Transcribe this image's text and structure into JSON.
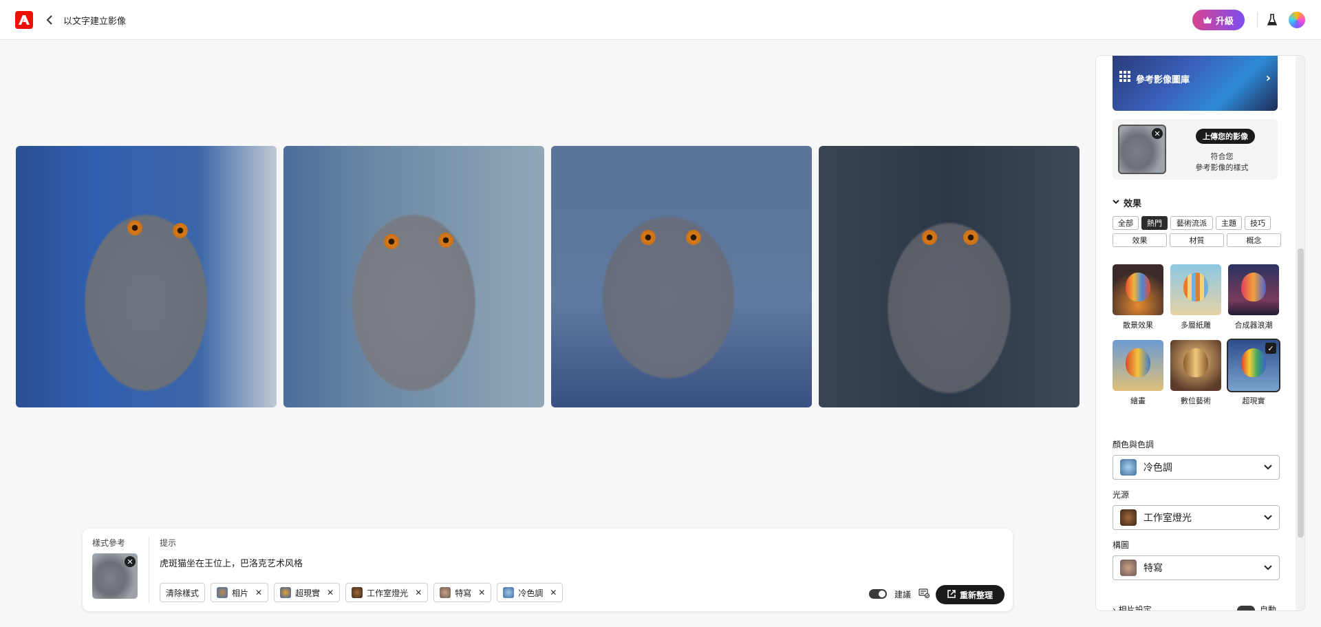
{
  "header": {
    "title": "以文字建立影像",
    "upgrade_label": "升級"
  },
  "images": [
    {
      "name": "generated-image-1"
    },
    {
      "name": "generated-image-2"
    },
    {
      "name": "generated-image-3"
    },
    {
      "name": "generated-image-4"
    }
  ],
  "prompt_bar": {
    "style_ref_label": "樣式參考",
    "prompt_label": "提示",
    "prompt_text": "虎斑猫坐在王位上，巴洛克艺术风格",
    "clear_label": "清除樣式",
    "chips": [
      "相片",
      "超現實",
      "工作室燈光",
      "特寫",
      "冷色調"
    ],
    "suggest_label": "建議",
    "refresh_label": "重新整理"
  },
  "panel": {
    "gallery_label": "參考影像圖庫",
    "upload_label": "上傳您的影像",
    "upload_sub1": "符合您",
    "upload_sub2": "參考影像的樣式",
    "effects_title": "效果",
    "tabs_row1": [
      "全部",
      "熱門",
      "藝術流派",
      "主題",
      "技巧"
    ],
    "tabs_row2": [
      "效果",
      "材質",
      "概念"
    ],
    "active_tab": "熱門",
    "effects": [
      "散景效果",
      "多層紙雕",
      "合成器浪潮",
      "繪畫",
      "數位藝術",
      "超現實"
    ],
    "selected_effect": "超現實",
    "color_label": "顏色與色調",
    "color_value": "冷色調",
    "light_label": "光源",
    "light_value": "工作室燈光",
    "comp_label": "構圖",
    "comp_value": "特寫",
    "camera_label": "相片設定",
    "auto_label": "自動"
  },
  "colors": {
    "brand": "#eb1000",
    "accent_dark": "#1b1b1b",
    "upgrade_gradient_start": "#d84390",
    "upgrade_gradient_end": "#7d4df0"
  }
}
